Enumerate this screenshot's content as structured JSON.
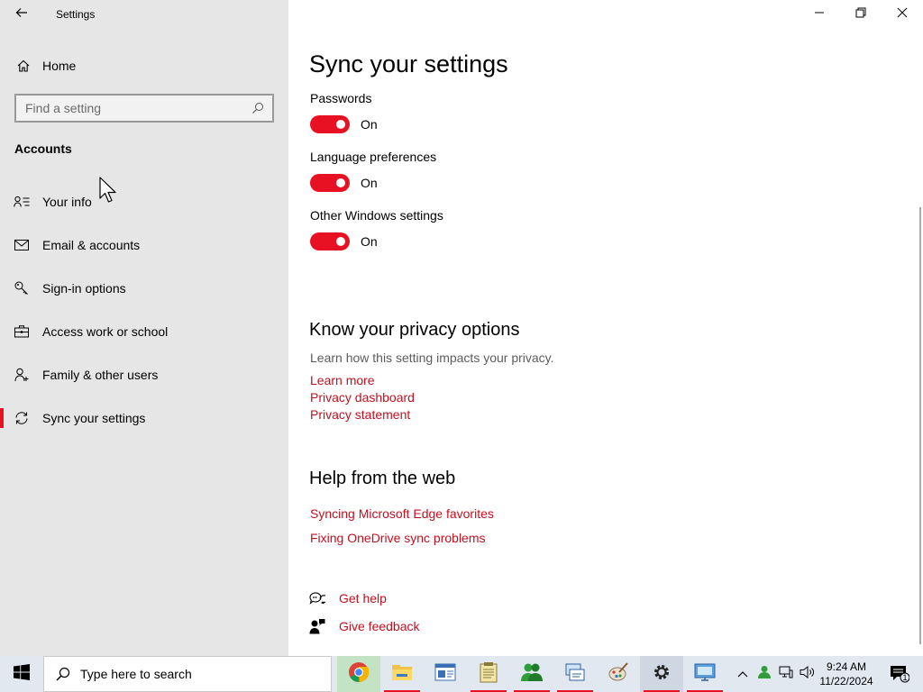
{
  "window": {
    "app_title": "Settings",
    "controls": [
      "minimize-icon",
      "restore-icon",
      "close-icon"
    ]
  },
  "sidebar": {
    "home_label": "Home",
    "search_placeholder": "Find a setting",
    "section_heading": "Accounts",
    "items": [
      {
        "label": "Your info",
        "icon": "person-icon"
      },
      {
        "label": "Email & accounts",
        "icon": "mail-icon"
      },
      {
        "label": "Sign-in options",
        "icon": "key-icon"
      },
      {
        "label": "Access work or school",
        "icon": "briefcase-icon"
      },
      {
        "label": "Family & other users",
        "icon": "people-icon"
      },
      {
        "label": "Sync your settings",
        "icon": "sync-icon",
        "selected": true
      }
    ]
  },
  "content": {
    "page_title": "Sync your settings",
    "settings": [
      {
        "label": "Passwords",
        "state": "On"
      },
      {
        "label": "Language preferences",
        "state": "On"
      },
      {
        "label": "Other Windows settings",
        "state": "On"
      }
    ],
    "privacy": {
      "heading": "Know your privacy options",
      "description": "Learn how this setting impacts your privacy.",
      "links": [
        "Learn more",
        "Privacy dashboard",
        "Privacy statement"
      ]
    },
    "help_web": {
      "heading": "Help from the web",
      "links": [
        "Syncing Microsoft Edge favorites",
        "Fixing OneDrive sync problems"
      ]
    },
    "support": {
      "get_help": "Get help",
      "give_feedback": "Give feedback"
    }
  },
  "colors": {
    "accent": "#e81123",
    "link": "#c50f1f",
    "sidebar_bg": "#e6e6e6"
  },
  "taskbar": {
    "search_text": "Type here to search",
    "apps": [
      "chrome-icon",
      "file-explorer-icon",
      "app-window-icon",
      "notepad-icon",
      "users-icon",
      "network-icon",
      "paint-icon",
      "settings-gear-icon",
      "remote-desktop-icon"
    ],
    "time": "9:24 AM",
    "date": "11/22/2024",
    "notification_count": "1"
  }
}
